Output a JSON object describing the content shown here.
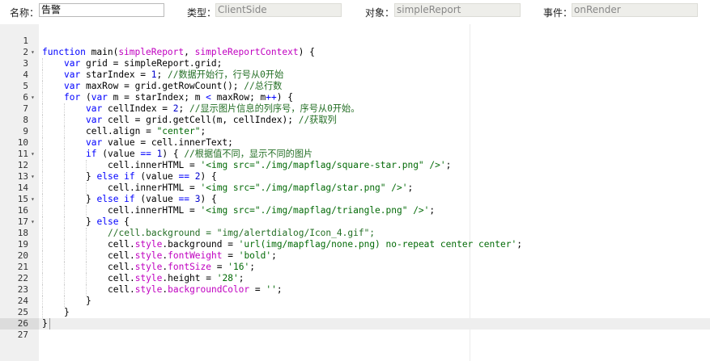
{
  "form": {
    "name_label": "名称：",
    "name_value": "告警",
    "type_label": "类型：",
    "type_value": "ClientSide",
    "object_label": "对象：",
    "object_value": "simpleReport",
    "event_label": "事件：",
    "event_value": "onRender"
  },
  "editor": {
    "fold_icon": "triangle-down-icon",
    "lines": [
      {
        "n": "1",
        "fold": false,
        "indent": 0,
        "tokens": []
      },
      {
        "n": "2",
        "fold": true,
        "indent": 0,
        "tokens": [
          [
            "kw",
            "function"
          ],
          [
            "txt",
            " main("
          ],
          [
            "param",
            "simpleReport"
          ],
          [
            "txt",
            ", "
          ],
          [
            "param",
            "simpleReportContext"
          ],
          [
            "txt",
            ") {"
          ]
        ]
      },
      {
        "n": "3",
        "fold": false,
        "indent": 1,
        "tokens": [
          [
            "kw",
            "var"
          ],
          [
            "txt",
            " grid = simpleReport.grid;"
          ]
        ]
      },
      {
        "n": "4",
        "fold": false,
        "indent": 1,
        "tokens": [
          [
            "kw",
            "var"
          ],
          [
            "txt",
            " starIndex = "
          ],
          [
            "num",
            "1"
          ],
          [
            "txt",
            "; "
          ],
          [
            "cmt",
            "//数据开始行，行号从0开始"
          ]
        ]
      },
      {
        "n": "5",
        "fold": false,
        "indent": 1,
        "tokens": [
          [
            "kw",
            "var"
          ],
          [
            "txt",
            " maxRow = grid.getRowCount(); "
          ],
          [
            "cmt",
            "//总行数"
          ]
        ]
      },
      {
        "n": "6",
        "fold": true,
        "indent": 1,
        "tokens": [
          [
            "kw",
            "for"
          ],
          [
            "txt",
            " ("
          ],
          [
            "kw",
            "var"
          ],
          [
            "txt",
            " m = starIndex; m "
          ],
          [
            "kw",
            "<"
          ],
          [
            "txt",
            " maxRow; m"
          ],
          [
            "kw",
            "++"
          ],
          [
            "txt",
            ") {"
          ]
        ]
      },
      {
        "n": "7",
        "fold": false,
        "indent": 2,
        "tokens": [
          [
            "kw",
            "var"
          ],
          [
            "txt",
            " cellIndex = "
          ],
          [
            "num",
            "2"
          ],
          [
            "txt",
            "; "
          ],
          [
            "cmt",
            "//显示图片信息的列序号，序号从0开始。"
          ]
        ]
      },
      {
        "n": "8",
        "fold": false,
        "indent": 2,
        "tokens": [
          [
            "kw",
            "var"
          ],
          [
            "txt",
            " cell = grid.getCell(m, cellIndex); "
          ],
          [
            "cmt",
            "//获取列"
          ]
        ]
      },
      {
        "n": "9",
        "fold": false,
        "indent": 2,
        "tokens": [
          [
            "txt",
            "cell.align = "
          ],
          [
            "str",
            "\"center\""
          ],
          [
            "txt",
            ";"
          ]
        ]
      },
      {
        "n": "10",
        "fold": false,
        "indent": 2,
        "tokens": [
          [
            "kw",
            "var"
          ],
          [
            "txt",
            " value = cell.innerText;"
          ]
        ]
      },
      {
        "n": "11",
        "fold": true,
        "indent": 2,
        "tokens": [
          [
            "kw",
            "if"
          ],
          [
            "txt",
            " (value "
          ],
          [
            "kw",
            "=="
          ],
          [
            "txt",
            " "
          ],
          [
            "num",
            "1"
          ],
          [
            "txt",
            ") { "
          ],
          [
            "cmt",
            "//根据值不同，显示不同的图片"
          ]
        ]
      },
      {
        "n": "12",
        "fold": false,
        "indent": 3,
        "tokens": [
          [
            "txt",
            "cell.innerHTML = "
          ],
          [
            "str",
            "'<img src=\"./img/mapflag/square-star.png\" />'"
          ],
          [
            "txt",
            ";"
          ]
        ]
      },
      {
        "n": "13",
        "fold": true,
        "indent": 2,
        "tokens": [
          [
            "txt",
            "} "
          ],
          [
            "kw",
            "else if"
          ],
          [
            "txt",
            " (value "
          ],
          [
            "kw",
            "=="
          ],
          [
            "txt",
            " "
          ],
          [
            "num",
            "2"
          ],
          [
            "txt",
            ") {"
          ]
        ]
      },
      {
        "n": "14",
        "fold": false,
        "indent": 3,
        "tokens": [
          [
            "txt",
            "cell.innerHTML = "
          ],
          [
            "str",
            "'<img src=\"./img/mapflag/star.png\" />'"
          ],
          [
            "txt",
            ";"
          ]
        ]
      },
      {
        "n": "15",
        "fold": true,
        "indent": 2,
        "tokens": [
          [
            "txt",
            "} "
          ],
          [
            "kw",
            "else if"
          ],
          [
            "txt",
            " (value "
          ],
          [
            "kw",
            "=="
          ],
          [
            "txt",
            " "
          ],
          [
            "num",
            "3"
          ],
          [
            "txt",
            ") {"
          ]
        ]
      },
      {
        "n": "16",
        "fold": false,
        "indent": 3,
        "tokens": [
          [
            "txt",
            "cell.innerHTML = "
          ],
          [
            "str",
            "'<img src=\"./img/mapflag/triangle.png\" />'"
          ],
          [
            "txt",
            ";"
          ]
        ]
      },
      {
        "n": "17",
        "fold": true,
        "indent": 2,
        "tokens": [
          [
            "txt",
            "} "
          ],
          [
            "kw",
            "else"
          ],
          [
            "txt",
            " {"
          ]
        ]
      },
      {
        "n": "18",
        "fold": false,
        "indent": 3,
        "tokens": [
          [
            "cmt",
            "//cell.background = \"img/alertdialog/Icon_4.gif\";"
          ]
        ]
      },
      {
        "n": "19",
        "fold": false,
        "indent": 3,
        "tokens": [
          [
            "txt",
            "cell."
          ],
          [
            "prop",
            "style"
          ],
          [
            "txt",
            ".background = "
          ],
          [
            "str",
            "'url(img/mapflag/none.png) no-repeat center center'"
          ],
          [
            "txt",
            ";"
          ]
        ]
      },
      {
        "n": "20",
        "fold": false,
        "indent": 3,
        "tokens": [
          [
            "txt",
            "cell."
          ],
          [
            "prop",
            "style"
          ],
          [
            "txt",
            "."
          ],
          [
            "prop",
            "fontWeight"
          ],
          [
            "txt",
            " = "
          ],
          [
            "str",
            "'bold'"
          ],
          [
            "txt",
            ";"
          ]
        ]
      },
      {
        "n": "21",
        "fold": false,
        "indent": 3,
        "tokens": [
          [
            "txt",
            "cell."
          ],
          [
            "prop",
            "style"
          ],
          [
            "txt",
            "."
          ],
          [
            "prop",
            "fontSize"
          ],
          [
            "txt",
            " = "
          ],
          [
            "str",
            "'16'"
          ],
          [
            "txt",
            ";"
          ]
        ]
      },
      {
        "n": "22",
        "fold": false,
        "indent": 3,
        "tokens": [
          [
            "txt",
            "cell."
          ],
          [
            "prop",
            "style"
          ],
          [
            "txt",
            ".height = "
          ],
          [
            "str",
            "'28'"
          ],
          [
            "txt",
            ";"
          ]
        ]
      },
      {
        "n": "23",
        "fold": false,
        "indent": 3,
        "tokens": [
          [
            "txt",
            "cell."
          ],
          [
            "prop",
            "style"
          ],
          [
            "txt",
            "."
          ],
          [
            "prop",
            "backgroundColor"
          ],
          [
            "txt",
            " = "
          ],
          [
            "str",
            "''"
          ],
          [
            "txt",
            ";"
          ]
        ]
      },
      {
        "n": "24",
        "fold": false,
        "indent": 2,
        "tokens": [
          [
            "txt",
            "}"
          ]
        ]
      },
      {
        "n": "25",
        "fold": false,
        "indent": 1,
        "tokens": [
          [
            "txt",
            "}"
          ]
        ]
      },
      {
        "n": "26",
        "fold": false,
        "indent": 0,
        "tokens": [
          [
            "txt",
            "}"
          ]
        ]
      },
      {
        "n": "27",
        "fold": false,
        "indent": 0,
        "tokens": []
      }
    ]
  }
}
